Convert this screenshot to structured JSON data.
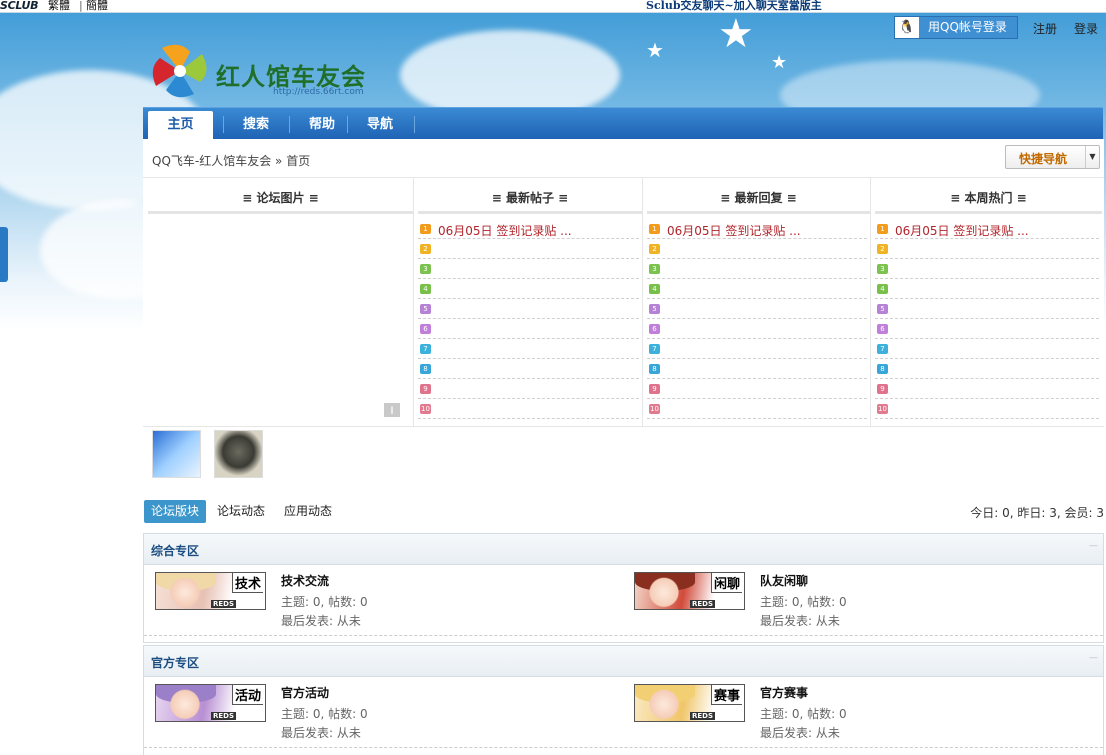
{
  "topbar": {
    "logo": "SCLUB",
    "lang_trad": "繁體",
    "separator": "|",
    "lang_simp": "簡體",
    "marquee": "Sclub交友聊天~加入聊天室當版主"
  },
  "header": {
    "qq_login": "用QQ帐号登录",
    "register": "注册",
    "login": "登录",
    "site_name": "红人馆车友会",
    "site_url": "http://reds.66rt.com"
  },
  "nav": {
    "items": [
      {
        "label": "主页"
      },
      {
        "label": "搜索"
      },
      {
        "label": "帮助"
      },
      {
        "label": "导航"
      }
    ]
  },
  "breadcrumb": {
    "text": "QQ飞车-红人馆车友会 » 首页"
  },
  "quick_nav": {
    "label": "快捷导航"
  },
  "portal": {
    "columns": [
      {
        "title": "≡ 论坛图片 ≡"
      },
      {
        "title": "≡ 最新帖子 ≡",
        "first": "06月05日 签到记录贴 ..."
      },
      {
        "title": "≡ 最新回复 ≡",
        "first": "06月05日 签到记录贴 ..."
      },
      {
        "title": "≡ 本周热门 ≡",
        "first": "06月05日 签到记录贴 ..."
      }
    ],
    "rank_numbers": [
      "1",
      "2",
      "3",
      "4",
      "5",
      "6",
      "7",
      "8",
      "9",
      "10"
    ],
    "rank_colors": [
      "#f29b1c",
      "#f0b324",
      "#7cc24f",
      "#78c049",
      "#b582d6",
      "#c07fd8",
      "#3cb1dc",
      "#38a6d8",
      "#e0728c",
      "#e27a8f"
    ]
  },
  "tabs": {
    "forum": "论坛版块",
    "activity": "论坛动态",
    "apps": "应用动态"
  },
  "stats": {
    "text": "今日: 0, 昨日: 3, 会员: 3"
  },
  "categories": [
    {
      "title": "综合专区",
      "collapse": "—",
      "forums": [
        {
          "tag": "技术",
          "reds": "REDS",
          "name": "技术交流",
          "counts": "主题: 0, 帖数: 0",
          "last": "最后发表: 从未"
        },
        {
          "tag": "闲聊",
          "reds": "REDS",
          "name": "队友闲聊",
          "counts": "主题: 0, 帖数: 0",
          "last": "最后发表: 从未"
        }
      ]
    },
    {
      "title": "官方专区",
      "collapse": "—",
      "forums": [
        {
          "tag": "活动",
          "reds": "REDS",
          "name": "官方活动",
          "counts": "主题: 0, 帖数: 0",
          "last": "最后发表: 从未"
        },
        {
          "tag": "赛事",
          "reds": "REDS",
          "name": "官方赛事",
          "counts": "主题: 0, 帖数: 0",
          "last": "最后发表: 从未"
        }
      ]
    }
  ]
}
